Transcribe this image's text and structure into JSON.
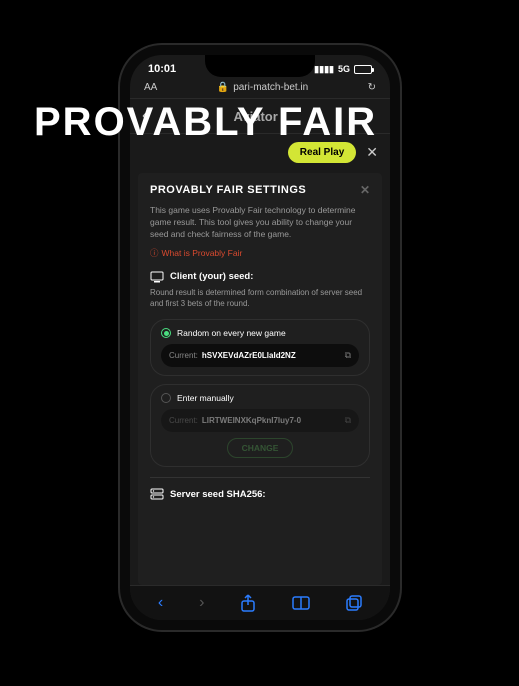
{
  "overlay": {
    "title": "PROVABLY FAIR"
  },
  "status": {
    "time": "10:01",
    "network": "5G"
  },
  "browser": {
    "text_size": "AA",
    "url": "pari-match-bet.in"
  },
  "app_header": {
    "title": "Aviator"
  },
  "mode_bar": {
    "real_play": "Real Play"
  },
  "modal": {
    "title": "PROVABLY FAIR SETTINGS",
    "description": "This game uses Provably Fair technology to determine game result. This tool gives you ability to change your seed and check fairness of the game.",
    "info_link": "What is Provably Fair",
    "client_seed": {
      "title": "Client (your) seed:",
      "description": "Round result is determined form combination of server seed and first 3 bets of the round.",
      "random_option": "Random on every new game",
      "random_current_label": "Current:",
      "random_current_value": "hSVXEVdAZrE0LlaId2NZ",
      "manual_option": "Enter manually",
      "manual_current_label": "Current:",
      "manual_current_value": "LlRTWEINXKqPknI7luy7-0",
      "change_button": "CHANGE"
    },
    "server_seed": {
      "title": "Server seed SHA256:"
    }
  }
}
